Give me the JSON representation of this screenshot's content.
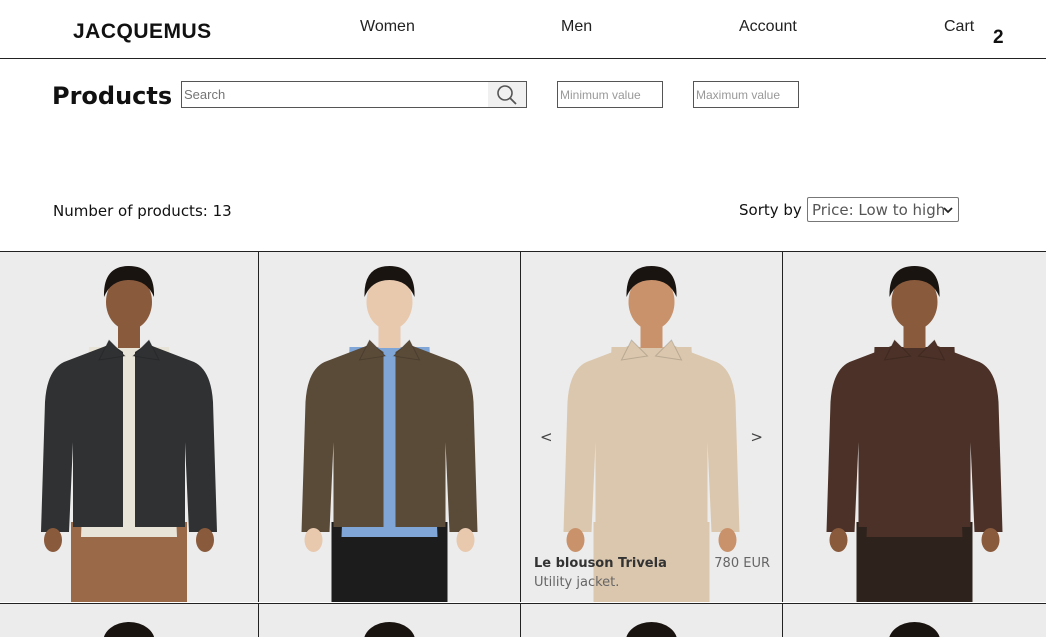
{
  "header": {
    "logo": "JACQUEMUS",
    "nav": {
      "women": "Women",
      "men": "Men",
      "account": "Account",
      "cart": "Cart"
    },
    "cart_count": "2"
  },
  "filters": {
    "title": "Products",
    "search_placeholder": "Search",
    "min_placeholder": "Minimum value",
    "max_placeholder": "Maximum value",
    "product_count": "Number of products: 13",
    "sort_label": "Sorty by",
    "sort_selected": "Price: Low to high"
  },
  "products": [
    {
      "jacket_color": "#2f3132",
      "skin": "#8a5a3c",
      "hair": "#1a1411",
      "under": "#e9e4d8",
      "pants": "#9a6a48"
    },
    {
      "jacket_color": "#5a4a38",
      "skin": "#e8c9ae",
      "hair": "#1a1411",
      "under": "#7fa6d6",
      "pants": "#1c1c1c"
    },
    {
      "jacket_color": "#dbc7ad",
      "skin": "#c9926b",
      "hair": "#1a1411",
      "under": "#dbc7ad",
      "pants": "#dbc7ad",
      "name": "Le blouson Trivela",
      "price": "780 EUR",
      "description": "Utility jacket.",
      "arrow_left": "<",
      "arrow_right": ">"
    },
    {
      "jacket_color": "#4b3127",
      "skin": "#8a5a3c",
      "hair": "#1a1411",
      "under": "#4b3127",
      "pants": "#2e221c"
    }
  ]
}
